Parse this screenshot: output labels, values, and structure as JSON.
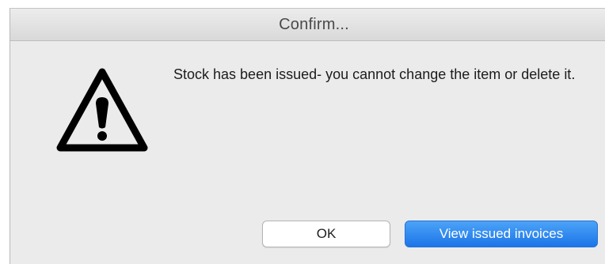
{
  "dialog": {
    "title": "Confirm...",
    "message": "Stock has been issued- you cannot change the item or delete it.",
    "icon": "warning-icon"
  },
  "buttons": {
    "ok_label": "OK",
    "view_label": "View issued invoices"
  },
  "colors": {
    "primary_button": "#1f7ae9",
    "dialog_background": "#ebebeb"
  }
}
